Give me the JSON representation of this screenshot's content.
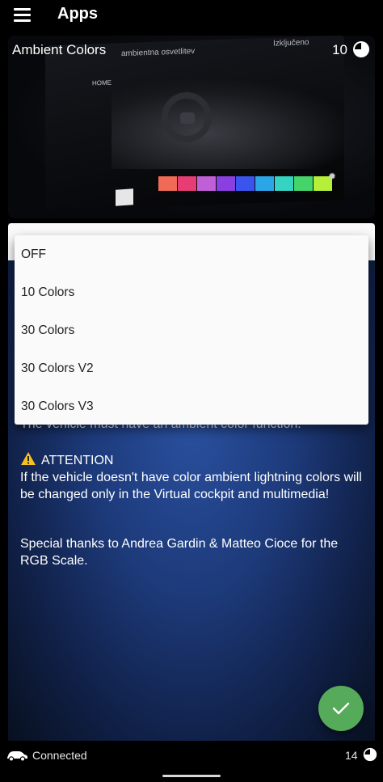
{
  "appbar": {
    "title": "Apps"
  },
  "card": {
    "title": "Ambient Colors",
    "count": "10",
    "screen_header": "ambientna osvetlitev",
    "screen_off": "Izključeno",
    "screen_home": "HOME",
    "swatch_colors": [
      "#f06a55",
      "#e63d74",
      "#c060d8",
      "#8a3fe0",
      "#3a55ee",
      "#2aa6e8",
      "#35d3c2",
      "#44d46a",
      "#b6ef3a"
    ]
  },
  "dropdown": {
    "options": [
      "OFF",
      "10 Colors",
      "30 Colors",
      "30 Colors V2",
      "30 Colors V3"
    ]
  },
  "content": {
    "description": "The vehicle must have an ambient color function.",
    "attention_title": "ATTENTION",
    "attention_body": "If the vehicle doesn't have color ambient lightning colors will be changed only in the Virtual cockpit and multimedia!",
    "thanks": "Special thanks to Andrea Gardin & Matteo Cioce for the RGB Scale."
  },
  "status": {
    "connection": "Connected",
    "count": "14"
  },
  "colors": {
    "accent_green": "#55ab5a",
    "background_blue": "#2b52a2"
  }
}
